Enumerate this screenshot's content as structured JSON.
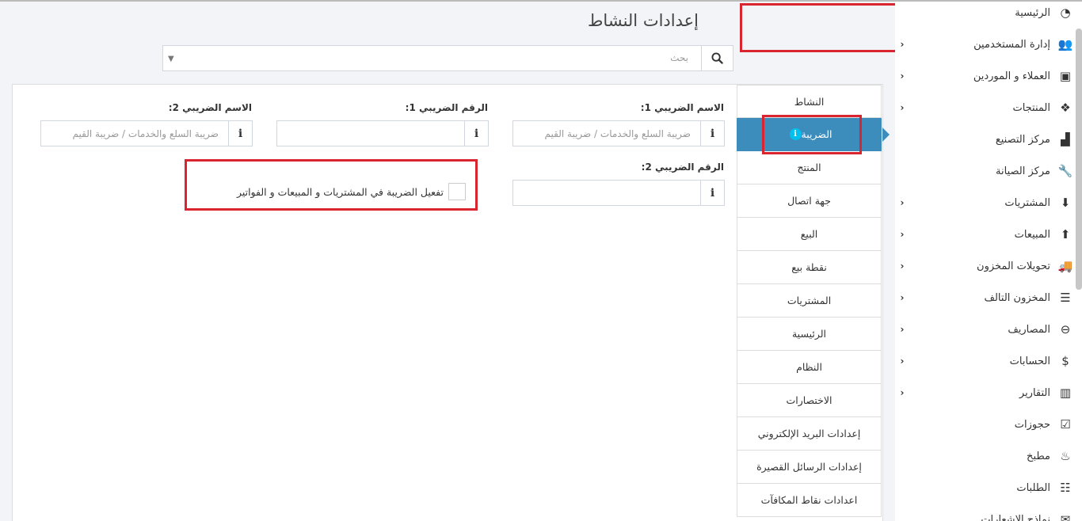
{
  "page": {
    "title": "إعدادات النشاط"
  },
  "search": {
    "placeholder": "بحث"
  },
  "sidebar": {
    "items": [
      {
        "label": "الرئيسية",
        "icon": "dashboard-icon",
        "glyph": "◔",
        "arrow": false
      },
      {
        "label": "إدارة المستخدمين",
        "icon": "users-icon",
        "glyph": "👥",
        "arrow": true
      },
      {
        "label": "العملاء و الموردين",
        "icon": "address-book-icon",
        "glyph": "▣",
        "arrow": true
      },
      {
        "label": "المنتجات",
        "icon": "cubes-icon",
        "glyph": "❖",
        "arrow": true
      },
      {
        "label": "مركز التصنيع",
        "icon": "industry-icon",
        "glyph": "▟",
        "arrow": false
      },
      {
        "label": "مركز الصيانة",
        "icon": "wrench-icon",
        "glyph": "🔧",
        "arrow": false
      },
      {
        "label": "المشتريات",
        "icon": "arrow-circle-down-icon",
        "glyph": "⬇",
        "arrow": true
      },
      {
        "label": "المبيعات",
        "icon": "arrow-circle-up-icon",
        "glyph": "⬆",
        "arrow": true
      },
      {
        "label": "تحويلات المخزون",
        "icon": "truck-icon",
        "glyph": "🚚",
        "arrow": true
      },
      {
        "label": "المخزون التالف",
        "icon": "database-icon",
        "glyph": "☰",
        "arrow": true
      },
      {
        "label": "المصاريف",
        "icon": "minus-circle-icon",
        "glyph": "⊖",
        "arrow": true
      },
      {
        "label": "الحسابات",
        "icon": "money-check-icon",
        "glyph": "$",
        "arrow": true
      },
      {
        "label": "التقارير",
        "icon": "bar-chart-icon",
        "glyph": "▥",
        "arrow": true
      },
      {
        "label": "حجوزات",
        "icon": "calendar-check-icon",
        "glyph": "☑",
        "arrow": false
      },
      {
        "label": "مطبخ",
        "icon": "fire-icon",
        "glyph": "♨",
        "arrow": false
      },
      {
        "label": "الطلبات",
        "icon": "list-alt-icon",
        "glyph": "☷",
        "arrow": false
      },
      {
        "label": "نماذج الإشعارات",
        "icon": "envelope-icon",
        "glyph": "✉",
        "arrow": false
      }
    ]
  },
  "tabs": [
    {
      "label": "النشاط",
      "active": false
    },
    {
      "label": "الضريبة",
      "active": true
    },
    {
      "label": "المنتج",
      "active": false
    },
    {
      "label": "جهة اتصال",
      "active": false
    },
    {
      "label": "البيع",
      "active": false
    },
    {
      "label": "نقطة بيع",
      "active": false
    },
    {
      "label": "المشتريات",
      "active": false
    },
    {
      "label": "الرئيسية",
      "active": false
    },
    {
      "label": "النظام",
      "active": false
    },
    {
      "label": "الاختصارات",
      "active": false
    },
    {
      "label": "إعدادات البريد الإلكتروني",
      "active": false
    },
    {
      "label": "إعدادات الرسائل القصيرة",
      "active": false
    },
    {
      "label": "اعدادات نقاط المكافآت",
      "active": false
    }
  ],
  "tax_form": {
    "tax_name_1": {
      "label": "الاسم الضريبي 1:",
      "placeholder": "ضريبة السلع والخدمات / ضريبة القيم"
    },
    "tax_number_1": {
      "label": "الرقم الضريبي 1:",
      "placeholder": ""
    },
    "tax_name_2": {
      "label": "الاسم الضريبي 2:",
      "placeholder": "ضريبة السلع والخدمات / ضريبة القيم"
    },
    "tax_number_2": {
      "label": "الرقم الضريبي 2:",
      "placeholder": ""
    },
    "enable_tax": {
      "label": "تفعيل الضريبة في المشتريات و المبيعات و الفواتير",
      "checked": false
    }
  },
  "colors": {
    "accent": "#3c8dbc",
    "highlight": "#d8252f",
    "info": "#00c0ef"
  }
}
